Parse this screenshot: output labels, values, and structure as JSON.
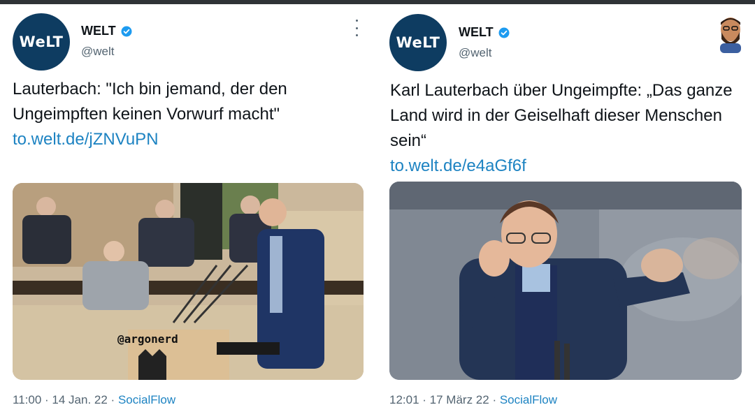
{
  "colors": {
    "welt_navy": "#0e3c61",
    "link_blue": "#1d83c2",
    "muted": "#536471",
    "verified": "#1d9bf0"
  },
  "tweets": [
    {
      "avatar_text": "WeLT",
      "name": "WELT",
      "handle": "@welt",
      "verified_icon": "verified-badge-icon",
      "text": "Lauterbach: \"Ich bin jemand, der den Ungeimpften keinen Vorwurf macht\"",
      "link": "to.welt.de/jZNVuPN",
      "watermark": "@argonerd",
      "time": "11:00",
      "date": "14 Jan. 22",
      "source": "SocialFlow"
    },
    {
      "avatar_text": "WeLT",
      "name": "WELT",
      "handle": "@welt",
      "verified_icon": "verified-badge-icon",
      "text": "Karl Lauterbach über Ungeimpfte: „Das ganze Land wird in der Geiselhaft dieser Menschen sein“",
      "link": "to.welt.de/e4aGf6f",
      "time": "12:01",
      "date": "17 März 22",
      "source": "SocialFlow"
    }
  ]
}
